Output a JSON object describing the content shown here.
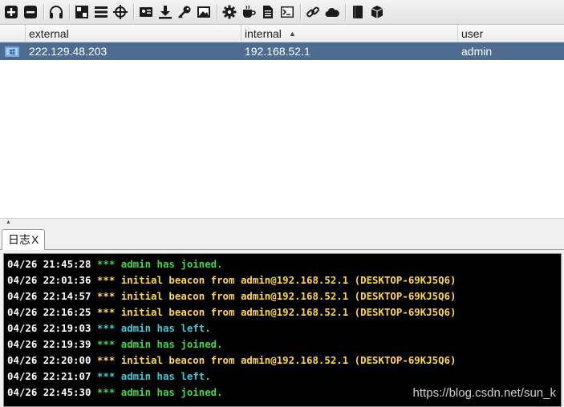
{
  "toolbar": {
    "icons": [
      "plus-icon",
      "minus-icon",
      "headphones-icon",
      "pivot-graph-icon",
      "list-view-icon",
      "target-icon",
      "credentials-icon",
      "download-icon",
      "key-icon",
      "screenshot-icon",
      "settings-icon",
      "coffee-icon",
      "document-icon",
      "console-icon",
      "link-icon",
      "cloud-icon",
      "book-icon",
      "package-icon"
    ]
  },
  "table": {
    "headers": [
      "",
      "external",
      "internal",
      "user"
    ],
    "sort_indicator": "▲",
    "rows": [
      {
        "external": "222.129.48.203",
        "internal": "192.168.52.1",
        "user": "admin"
      }
    ]
  },
  "splitter": {
    "arrows": "▲\n▼"
  },
  "tab": {
    "label": "日志",
    "close": "X"
  },
  "log": [
    {
      "ts": "04/26 21:45:28",
      "color": "green",
      "segments": [
        {
          "t": " *** ",
          "c": "green"
        },
        {
          "t": "admin",
          "c": "green"
        },
        {
          "t": " has joined.",
          "c": "green"
        }
      ]
    },
    {
      "ts": "04/26 22:01:36",
      "color": "yellow",
      "segments": [
        {
          "t": " *** initial beacon from ",
          "c": "yellow"
        },
        {
          "t": "admin@192.168.52.1",
          "c": "yellow"
        },
        {
          "t": " (DESKTOP-69KJ5Q6)",
          "c": "yellow"
        }
      ]
    },
    {
      "ts": "04/26 22:14:57",
      "color": "yellow",
      "segments": [
        {
          "t": " *** initial beacon from ",
          "c": "yellow"
        },
        {
          "t": "admin@192.168.52.1",
          "c": "yellow"
        },
        {
          "t": " (DESKTOP-69KJ5Q6)",
          "c": "yellow"
        }
      ]
    },
    {
      "ts": "04/26 22:16:25",
      "color": "yellow",
      "segments": [
        {
          "t": " *** initial beacon from ",
          "c": "yellow"
        },
        {
          "t": "admin@192.168.52.1",
          "c": "yellow"
        },
        {
          "t": " (DESKTOP-69KJ5Q6)",
          "c": "yellow"
        }
      ]
    },
    {
      "ts": "04/26 22:19:03",
      "color": "teal",
      "segments": [
        {
          "t": " *** ",
          "c": "teal"
        },
        {
          "t": "admin",
          "c": "teal"
        },
        {
          "t": " has left.",
          "c": "teal"
        }
      ]
    },
    {
      "ts": "04/26 22:19:39",
      "color": "green",
      "segments": [
        {
          "t": " *** ",
          "c": "green"
        },
        {
          "t": "admin",
          "c": "green"
        },
        {
          "t": " has joined.",
          "c": "green"
        }
      ]
    },
    {
      "ts": "04/26 22:20:00",
      "color": "yellow",
      "segments": [
        {
          "t": " *** initial beacon from ",
          "c": "yellow"
        },
        {
          "t": "admin@192.168.52.1",
          "c": "yellow"
        },
        {
          "t": " (DESKTOP-69KJ5Q6)",
          "c": "yellow"
        }
      ]
    },
    {
      "ts": "04/26 22:21:07",
      "color": "teal",
      "segments": [
        {
          "t": " *** ",
          "c": "teal"
        },
        {
          "t": "admin",
          "c": "teal"
        },
        {
          "t": " has left.",
          "c": "teal"
        }
      ]
    },
    {
      "ts": "04/26 22:45:30",
      "color": "green",
      "segments": [
        {
          "t": " *** ",
          "c": "green"
        },
        {
          "t": "admin",
          "c": "green"
        },
        {
          "t": " has joined.",
          "c": "green"
        }
      ]
    }
  ],
  "watermark": "https://blog.csdn.net/sun_k",
  "colors": {
    "selected_row": "#4e6c92",
    "console_bg": "#000000",
    "green": "#3fd843",
    "yellow": "#ffd54a",
    "teal": "#3fc9d6"
  }
}
